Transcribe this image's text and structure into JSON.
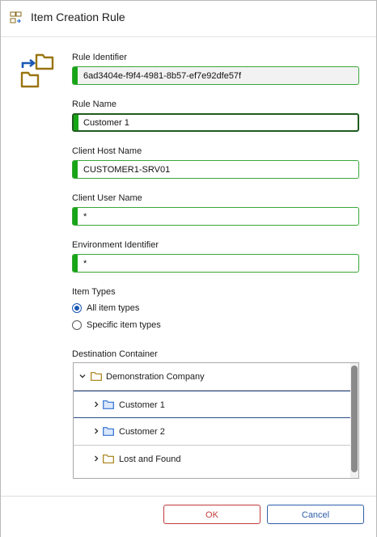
{
  "window": {
    "title": "Item Creation Rule"
  },
  "form": {
    "rule_identifier": {
      "label": "Rule Identifier",
      "value": "6ad3404e-f9f4-4981-8b57-ef7e92dfe57f"
    },
    "rule_name": {
      "label": "Rule Name",
      "value": "Customer 1"
    },
    "client_host_name": {
      "label": "Client Host Name",
      "value": "CUSTOMER1-SRV01"
    },
    "client_user_name": {
      "label": "Client User Name",
      "value": "*"
    },
    "environment_identifier": {
      "label": "Environment Identifier",
      "value": "*"
    },
    "item_types": {
      "label": "Item Types",
      "options": [
        {
          "label": "All item types",
          "checked": true
        },
        {
          "label": "Specific item types",
          "checked": false
        }
      ]
    },
    "destination": {
      "label": "Destination Container",
      "tree": [
        {
          "label": "Demonstration Company",
          "expanded": true,
          "level": 0,
          "icon": "folder-yellow-icon"
        },
        {
          "label": "Customer 1",
          "expanded": false,
          "level": 1,
          "icon": "folder-blue-icon",
          "selected": true
        },
        {
          "label": "Customer 2",
          "expanded": false,
          "level": 1,
          "icon": "folder-blue-icon"
        },
        {
          "label": "Lost and Found",
          "expanded": false,
          "level": 1,
          "icon": "folder-yellow-icon"
        }
      ]
    }
  },
  "buttons": {
    "ok": "OK",
    "cancel": "Cancel"
  },
  "colors": {
    "accent_green": "#16a516",
    "ok_red": "#c13a3a",
    "cancel_blue": "#2e5ea8",
    "folder_yellow": "#b8860b",
    "folder_blue": "#2e6fd1"
  }
}
